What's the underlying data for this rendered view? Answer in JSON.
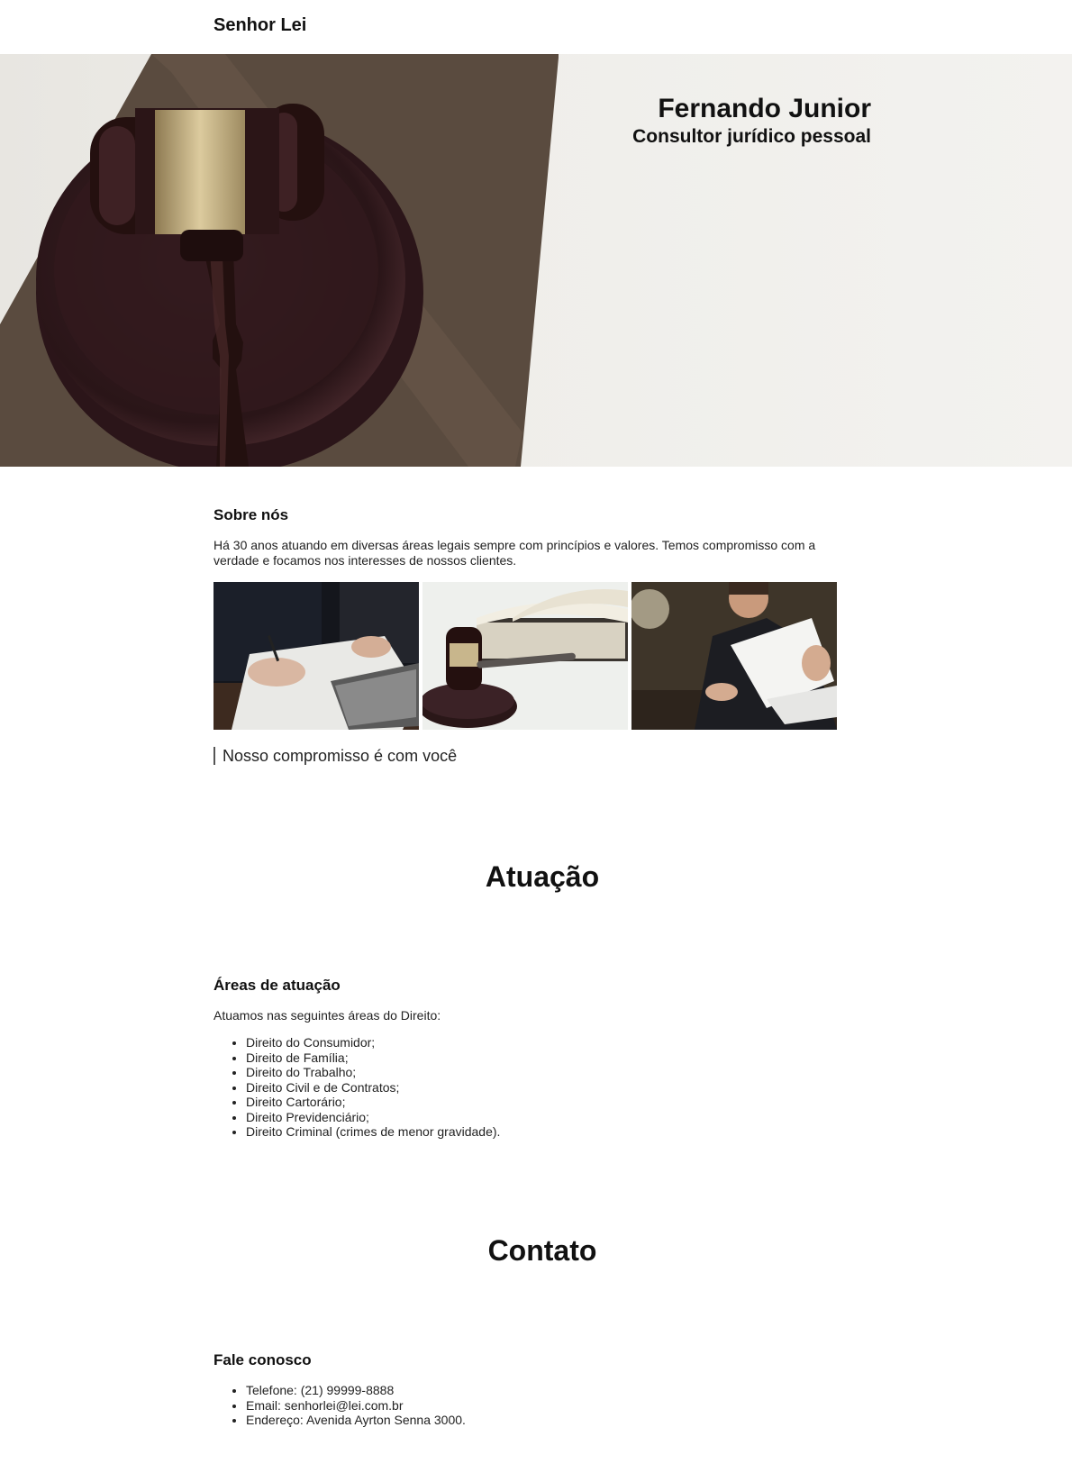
{
  "header": {
    "brand": "Senhor Lei"
  },
  "hero": {
    "name": "Fernando Junior",
    "role": "Consultor jurídico pessoal"
  },
  "about": {
    "title": "Sobre nós",
    "text": "Há 30 anos atuando em diversas áreas legais sempre com princípios e valores. Temos compromisso com a verdade e focamos nos interesses de nossos clientes.",
    "quote": "Nosso compromisso é com você"
  },
  "atuacao": {
    "section_title": "Atuação",
    "title": "Áreas de atuação",
    "intro": "Atuamos nas seguintes áreas do Direito:",
    "items": [
      "Direito do Consumidor;",
      "Direito de Família;",
      "Direito do Trabalho;",
      "Direito Civil e de Contratos;",
      "Direito Cartorário;",
      "Direito Previdenciário;",
      "Direito Criminal (crimes de menor gravidade)."
    ]
  },
  "contato": {
    "section_title": "Contato",
    "title": "Fale conosco",
    "items": [
      "Telefone: (21) 99999-8888",
      "Email: senhorlei@lei.com.br",
      "Endereço: Avenida Ayrton Senna 3000."
    ]
  },
  "colors": {
    "text": "#111111",
    "hero_bg": "#efeeea",
    "gavel_wood": "#3a1f22",
    "gavel_gold": "#c8b68c",
    "book": "#5e4f42"
  }
}
